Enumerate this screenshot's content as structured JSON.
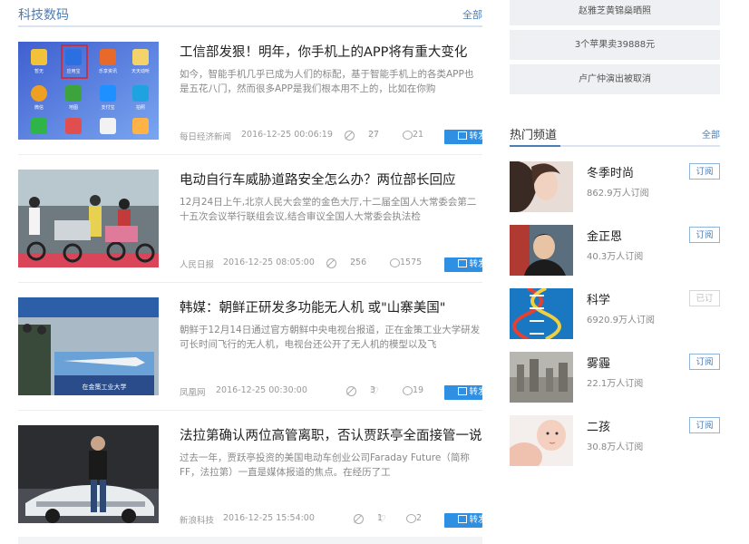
{
  "section": {
    "title": "科技数码",
    "more": "全部"
  },
  "articles": [
    {
      "title": "工信部发狠！明年，你手机上的APP将有重大变化",
      "summary": "如今，智能手机几乎已成为人们的标配，基于智能手机上的各类APP也是五花八门，然而很多APP是我们根本用不上的，比如在你购",
      "source": "每日经济新闻",
      "time": "2016-12-25 00:06:19",
      "likes": "27",
      "comments": "21",
      "share": "转发",
      "thumb_icon_labels": [
        "暂无",
        "应用宝",
        "乐享资讯",
        "天天动听",
        "微信",
        "地图",
        "支付宝",
        "拍照"
      ]
    },
    {
      "title": "电动自行车威胁道路安全怎么办？两位部长回应",
      "summary": "12月24日上午,北京人民大会堂的金色大厅,十二届全国人大常委会第二十五次会议举行联组会议,结合审议全国人大常委会执法检",
      "source": "人民日报",
      "time": "2016-12-25 08:05:00",
      "likes": "256",
      "comments": "1575",
      "share": "转发"
    },
    {
      "title": "韩媒：朝鲜正研发多功能无人机 或\"山寨美国\"",
      "summary": "朝鲜于12月14日通过官方朝鲜中央电视台报道，正在金策工业大学研发可长时间飞行的无人机，电视台还公开了无人机的模型以及飞",
      "source": "凤凰网",
      "time": "2016-12-25 00:30:00",
      "likes": "3",
      "comments": "19",
      "share": "转发",
      "thumb_caption": "在金策工业大学"
    },
    {
      "title": "法拉第确认两位高管离职，否认贾跃亭全面接管一说",
      "summary": "过去一年，贾跃亭投资的美国电动车创业公司Faraday Future（简称FF，法拉第）一直是媒体报道的焦点。在经历了工",
      "source": "新浪科技",
      "time": "2016-12-25 15:54:00",
      "likes": "1",
      "comments": "2",
      "share": "转发"
    }
  ],
  "hot_links": [
    "赵雅芝黄锦燊晒照",
    "3个苹果卖39888元",
    "卢广仲演出被取消"
  ],
  "channels_header": {
    "title": "热门频道",
    "more": "全部"
  },
  "channels": [
    {
      "name": "冬季时尚",
      "subs": "862.9万人订阅",
      "button": "订阅",
      "subscribed": false
    },
    {
      "name": "金正恩",
      "subs": "40.3万人订阅",
      "button": "订阅",
      "subscribed": false
    },
    {
      "name": "科学",
      "subs": "6920.9万人订阅",
      "button": "已订",
      "subscribed": true
    },
    {
      "name": "雾霾",
      "subs": "22.1万人订阅",
      "button": "订阅",
      "subscribed": false
    },
    {
      "name": "二孩",
      "subs": "30.8万人订阅",
      "button": "订阅",
      "subscribed": false
    }
  ],
  "colors": {
    "accent": "#4d7db5",
    "share_button": "#2f8fe3",
    "panel_bg": "#eef0f3"
  }
}
